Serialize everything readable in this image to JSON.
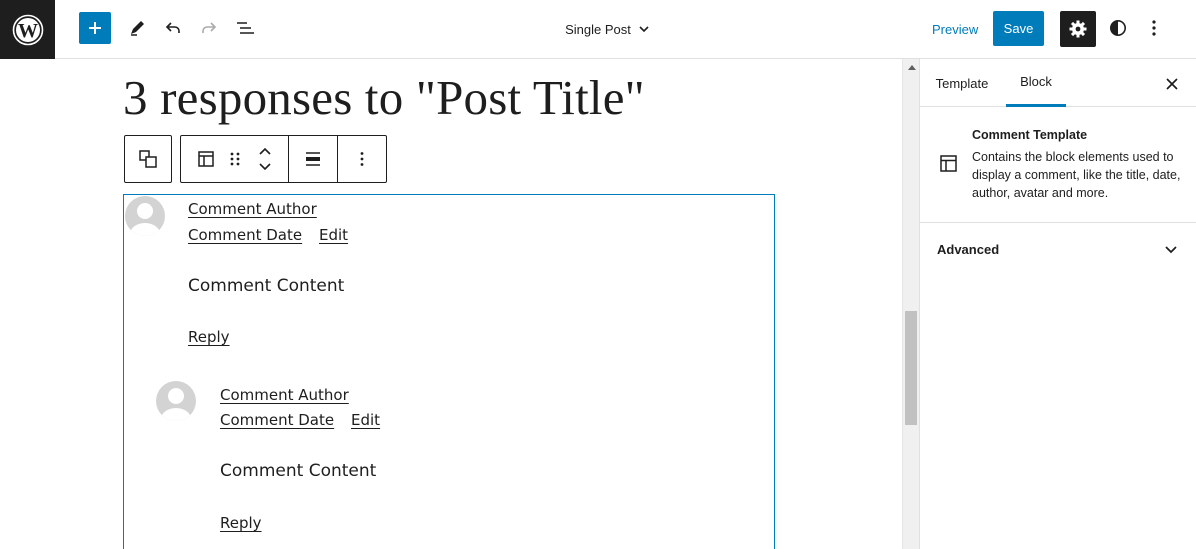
{
  "topbar": {
    "document_title": "Single Post",
    "preview_label": "Preview",
    "save_label": "Save"
  },
  "canvas": {
    "heading": "3 responses to \"Post Title\"",
    "comments": [
      {
        "author": "Comment Author",
        "date": "Comment Date",
        "edit": "Edit",
        "content": "Comment Content",
        "reply": "Reply"
      },
      {
        "author": "Comment Author",
        "date": "Comment Date",
        "edit": "Edit",
        "content": "Comment Content",
        "reply": "Reply"
      }
    ]
  },
  "sidebar": {
    "tabs": [
      "Template",
      "Block"
    ],
    "active_tab": "Block",
    "block": {
      "name": "Comment Template",
      "description": "Contains the block elements used to display a comment, like the title, date, author, avatar and more."
    },
    "advanced_label": "Advanced"
  },
  "colors": {
    "accent": "#007cba",
    "dark": "#1e1e1e"
  },
  "icons": [
    "wordpress-logo-icon",
    "plus-icon",
    "pencil-icon",
    "undo-icon",
    "redo-icon",
    "list-view-icon",
    "chevron-down-icon",
    "gear-icon",
    "contrast-icon",
    "more-vertical-icon",
    "close-icon",
    "comment-template-icon",
    "drag-handle-icon",
    "move-arrows-icon",
    "justify-icon"
  ]
}
